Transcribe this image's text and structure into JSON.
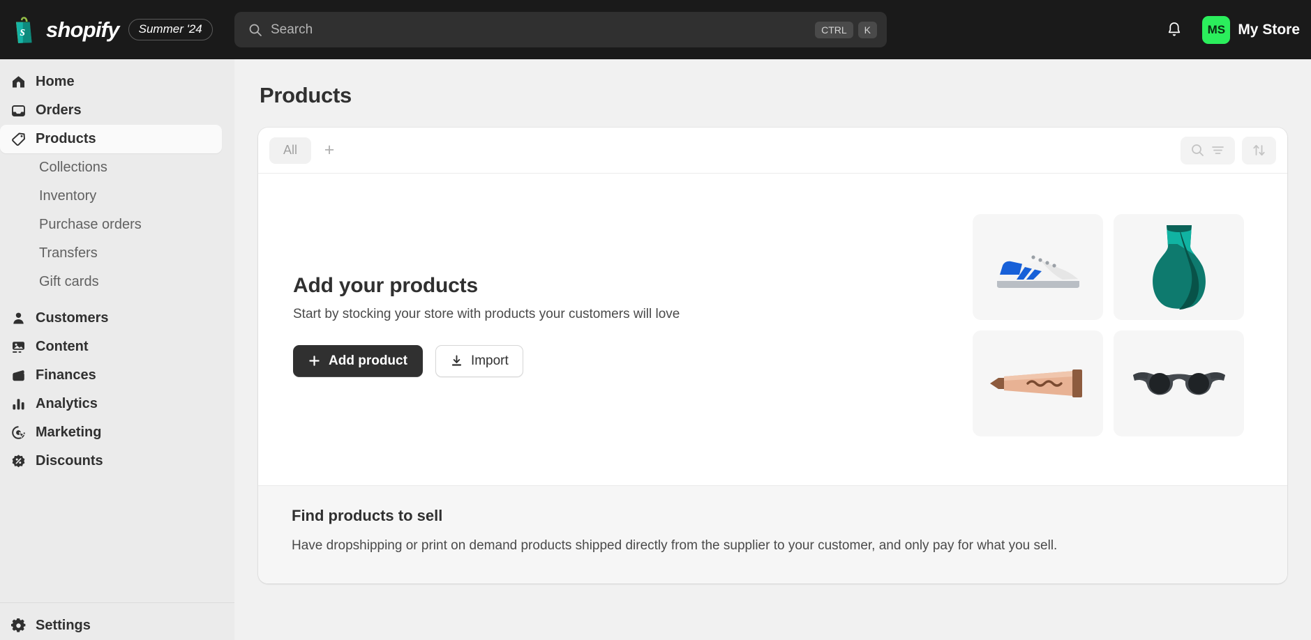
{
  "topbar": {
    "brand_name": "shopify",
    "brand_icon": "shopify-bag-icon",
    "season_badge": "Summer '24",
    "search": {
      "placeholder": "Search",
      "value": "",
      "icon": "search-icon",
      "shortcut_keys": [
        "CTRL",
        "K"
      ]
    },
    "notifications_icon": "bell-icon",
    "store": {
      "initials": "MS",
      "name": "My Store",
      "avatar_color": "#2bee5c"
    }
  },
  "sidebar": {
    "items": [
      {
        "label": "Home",
        "icon": "home-icon",
        "type": "main",
        "active": false
      },
      {
        "label": "Orders",
        "icon": "orders-inbox-icon",
        "type": "main",
        "active": false
      },
      {
        "label": "Products",
        "icon": "tag-icon",
        "type": "main",
        "active": true
      },
      {
        "label": "Collections",
        "icon": "",
        "type": "sub",
        "active": false
      },
      {
        "label": "Inventory",
        "icon": "",
        "type": "sub",
        "active": false
      },
      {
        "label": "Purchase orders",
        "icon": "",
        "type": "sub",
        "active": false
      },
      {
        "label": "Transfers",
        "icon": "",
        "type": "sub",
        "active": false
      },
      {
        "label": "Gift cards",
        "icon": "",
        "type": "sub",
        "active": false
      },
      {
        "label": "Customers",
        "icon": "person-icon",
        "type": "main",
        "active": false
      },
      {
        "label": "Content",
        "icon": "image-icon",
        "type": "main",
        "active": false
      },
      {
        "label": "Finances",
        "icon": "wallet-icon",
        "type": "main",
        "active": false
      },
      {
        "label": "Analytics",
        "icon": "bar-chart-icon",
        "type": "main",
        "active": false
      },
      {
        "label": "Marketing",
        "icon": "target-cursor-icon",
        "type": "main",
        "active": false
      },
      {
        "label": "Discounts",
        "icon": "discount-percent-icon",
        "type": "main",
        "active": false
      }
    ],
    "footer_item": {
      "label": "Settings",
      "icon": "gear-icon"
    }
  },
  "main": {
    "page_title": "Products",
    "toolbar": {
      "tabs": [
        {
          "label": "All",
          "selected": true
        }
      ],
      "add_tab_label": "+",
      "search_filter_icon": "search-filter-icon",
      "sort_icon": "sort-arrows-icon"
    },
    "empty_state": {
      "heading": "Add your products",
      "description": "Start by stocking your store with products your customers will love",
      "primary_button": {
        "label": "Add product",
        "icon": "plus-icon"
      },
      "secondary_button": {
        "label": "Import",
        "icon": "download-icon"
      },
      "thumbnails": [
        {
          "name": "sneaker-illustration"
        },
        {
          "name": "vase-illustration"
        },
        {
          "name": "cosmetic-tube-illustration"
        },
        {
          "name": "sunglasses-illustration"
        }
      ]
    },
    "find_products": {
      "heading": "Find products to sell",
      "description": "Have dropshipping or print on demand products shipped directly from the supplier to your customer, and only pay for what you sell."
    }
  }
}
